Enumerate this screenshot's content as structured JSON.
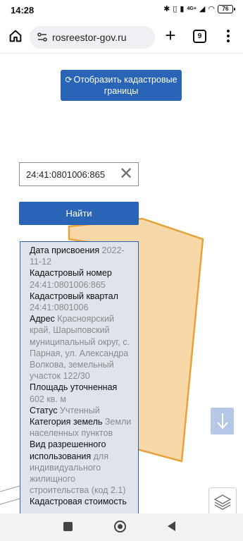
{
  "status_bar": {
    "time": "14:28",
    "icons": [
      "bluetooth-icon",
      "vibrate-icon",
      "lte-icon",
      "signal-icon",
      "wifi-icon"
    ],
    "network_label": "4G+",
    "battery": "76"
  },
  "browser": {
    "url": "rosreestor-gov.ru",
    "tab_count": "9"
  },
  "page": {
    "cadastral_button": "Отобразить кадастровые границы",
    "search_value": "24:41:0801006:865",
    "clear_symbol": "✕",
    "find_button": "Найти",
    "details": [
      {
        "label": "Дата присвоения",
        "value": "2022-11-12"
      },
      {
        "label": "Кадастровый номер",
        "value": "24:41:0801006:865"
      },
      {
        "label": "Кадастровый квартал",
        "value": "24:41:0801006"
      },
      {
        "label": "Адрес",
        "value": "Красноярский край, Шарыповский муниципальный округ, с. Парная, ул. Александра Волкова, земельный участок 122/30"
      },
      {
        "label": "Площадь уточненная",
        "value": "602 кв. м"
      },
      {
        "label": "Статус",
        "value": "Учтенный"
      },
      {
        "label": "Категория земель",
        "value": "Земли населенных пунктов"
      },
      {
        "label": "Вид разрешенного использования",
        "value": "для индивидуального жилищного строительства (код 2.1)"
      },
      {
        "label": "Кадастровая стоимость",
        "value": ""
      }
    ]
  },
  "colors": {
    "accent": "#2a64b6",
    "panel_bg": "#dfe3ec",
    "parcel_fill": "#f8d8a8",
    "parcel_stroke": "#e8a23a"
  }
}
